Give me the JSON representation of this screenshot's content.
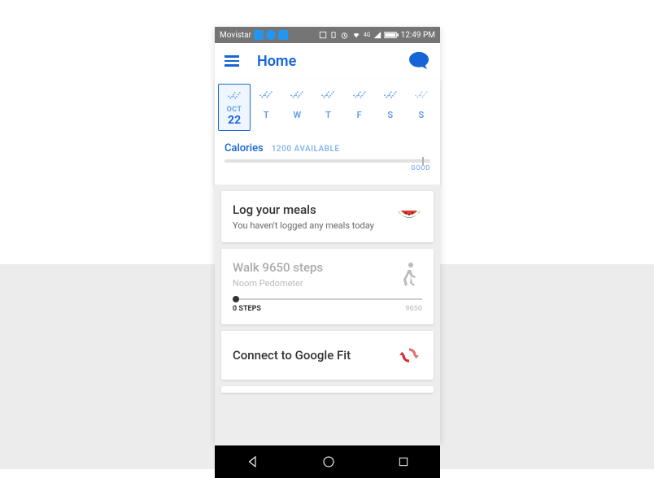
{
  "status": {
    "carrier": "Movistar",
    "time": "12:49 PM"
  },
  "header": {
    "title": "Home"
  },
  "days": {
    "selected": {
      "month": "OCT",
      "date": "22"
    },
    "rest": [
      "T",
      "W",
      "T",
      "F",
      "S",
      "S"
    ]
  },
  "calories": {
    "label": "Calories",
    "available": "1200 AVAILABLE",
    "quality": "GOOD"
  },
  "meals": {
    "title": "Log your meals",
    "sub": "You haven't logged any meals today"
  },
  "steps": {
    "title": "Walk 9650 steps",
    "sub": "Noom Pedometer",
    "current": "0 STEPS",
    "goal": "9650"
  },
  "fit": {
    "title": "Connect to Google Fit"
  }
}
